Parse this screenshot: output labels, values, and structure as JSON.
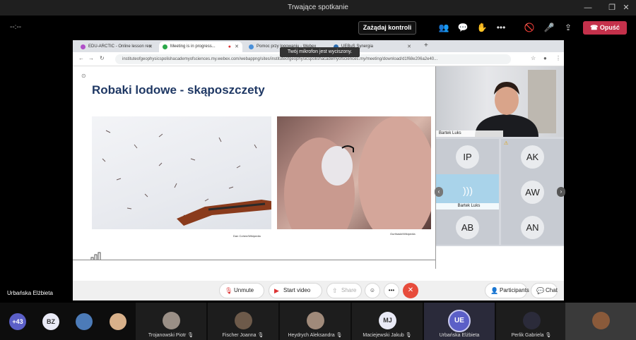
{
  "window": {
    "title": "Trwające spotkanie"
  },
  "toolbar": {
    "timer": "--:--",
    "request_control": "Zażądaj kontroli",
    "leave": "Opuść"
  },
  "tooltip": "Twój mikrofon jest wyciszony.",
  "browser": {
    "tabs": [
      {
        "label": "EDU-ARCTIC - Online lesson rec"
      },
      {
        "label": "Meeting is in progress..."
      },
      {
        "label": "Pomoc przy logowaniu - Webex"
      },
      {
        "label": "UEBuS Synergia"
      }
    ],
    "url": "instituteofgeophysicspolishacademyofsciences.my.webex.com/webappng/sites/instituteofgeophysicspolishacademyofsciences.my/meeting/download/d1f68e206a2e40..."
  },
  "slide": {
    "title": "Robaki lodowe - skąposzczety",
    "credit1": "Dan Cohen/Wikipedia",
    "credit2": "Gurthaski/Wikipedia"
  },
  "panel": {
    "video_name": "Bartek Luks",
    "tiles": [
      "IP",
      "AK",
      "AW",
      "AB",
      "AN"
    ],
    "active_name": "Bartek Luks"
  },
  "controls": {
    "unmute": "Unmute",
    "start_video": "Start video",
    "share": "Share",
    "participants": "Participants",
    "chat": "Chat"
  },
  "local_name": "Urbańska Elżbieta",
  "strip": {
    "more": "+43",
    "avatars": [
      "BZ"
    ],
    "participants": [
      {
        "name": "Trojanowski Piotr"
      },
      {
        "name": "Fischer Joanna"
      },
      {
        "name": "Heydrych Aleksandra"
      },
      {
        "name": "Maciejewski Jakub",
        "initials": "MJ"
      },
      {
        "name": "Urbańska Elżbieta",
        "initials": "UE"
      },
      {
        "name": "Perlik Gabriela"
      }
    ]
  }
}
